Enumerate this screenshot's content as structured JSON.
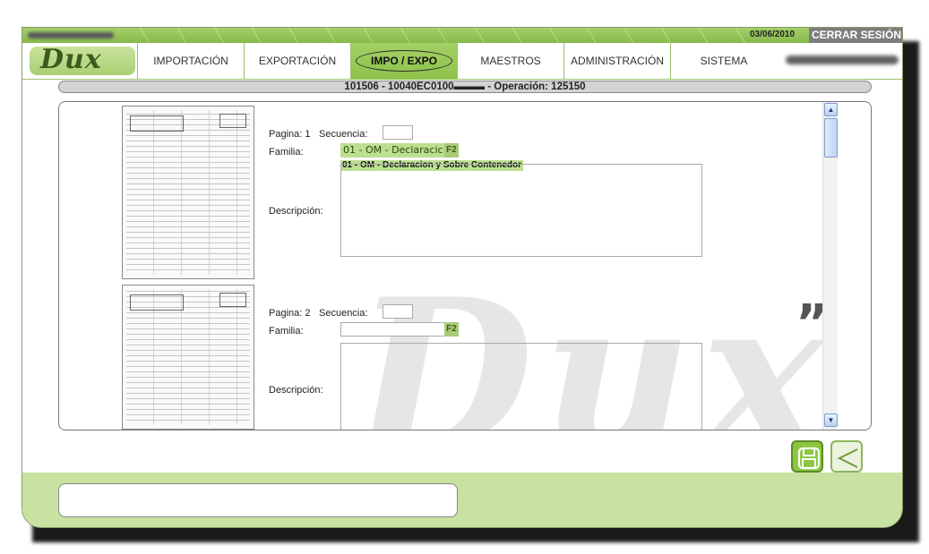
{
  "header": {
    "date": "03/06/2010",
    "logout_label": "CERRAR SESIÓN"
  },
  "logo": {
    "text": "Dux"
  },
  "nav": {
    "tabs": [
      {
        "label": "IMPORTACIÓN"
      },
      {
        "label": "EXPORTACIÓN"
      },
      {
        "label": "IMPO / EXPO",
        "active": true
      },
      {
        "label": "MAESTROS"
      },
      {
        "label": "ADMINISTRACIÓN"
      },
      {
        "label": "SISTEMA"
      }
    ]
  },
  "operation_bar": {
    "text": "101506 - 10040EC0100▬▬▬ - Operación: 125150"
  },
  "pages": [
    {
      "page_label": "Pagina: 1",
      "sequence_label": "Secuencia:",
      "family_label": "Familia:",
      "family_value": "01 - OM - Declaracic",
      "f2_label": "F2",
      "family_name": "01 - OM - Declaracion y Sobre Contenedor",
      "description_label": "Descripción:"
    },
    {
      "page_label": "Pagina: 2",
      "sequence_label": "Secuencia:",
      "family_label": "Familia:",
      "family_value": "",
      "f2_label": "F2",
      "family_name": "",
      "description_label": "Descripción:"
    }
  ],
  "scrollbar": {
    "up_icon": "▲",
    "down_icon": "▼"
  },
  "watermark": {
    "text": "Dux",
    "quote": "”"
  },
  "colors": {
    "accent": "#8dc24b",
    "bar": "#c7e2a1",
    "logout_bg": "#7d7d7d"
  }
}
